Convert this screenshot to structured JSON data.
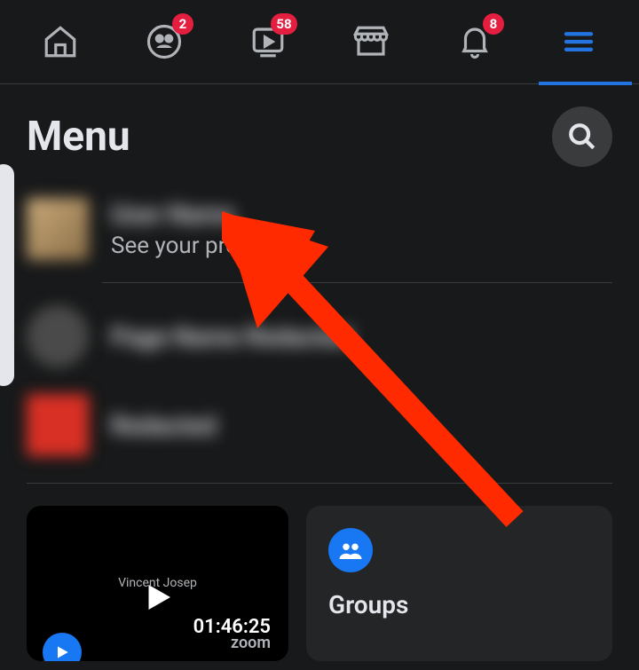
{
  "tabs": {
    "friends_badge": "2",
    "watch_badge": "58",
    "notifications_badge": "8"
  },
  "header": {
    "title": "Menu"
  },
  "profile": {
    "name": "User Name",
    "subtitle": "See your profile"
  },
  "shortcuts": {
    "item1_name": "Page Name Redacted",
    "item2_name": "Redacted"
  },
  "video": {
    "watermark": "Vincent Josep",
    "time": "01:46:25",
    "zoom": "zoom"
  },
  "groups": {
    "label": "Groups"
  },
  "colors": {
    "bg": "#18191a",
    "card": "#242526",
    "accent": "#1877f2",
    "badge": "#e41e3f",
    "text": "#e4e6eb",
    "subtext": "#b0b3b8",
    "arrow": "#ff2a00"
  }
}
